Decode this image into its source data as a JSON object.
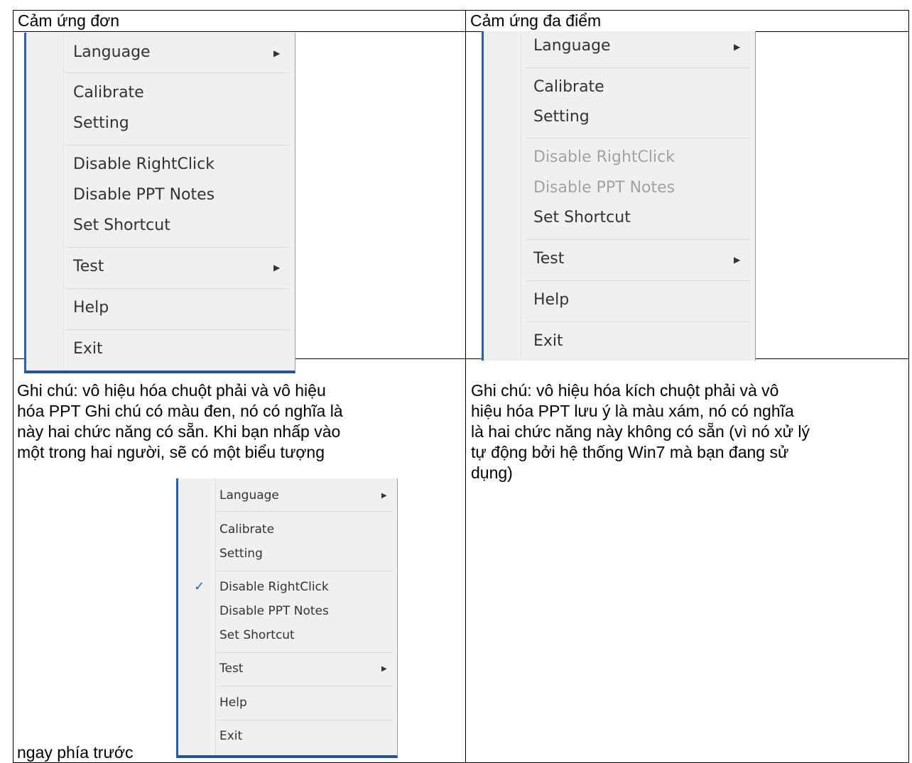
{
  "headers": {
    "left": "Cảm ứng đơn",
    "right": "Cảm ứng đa điểm"
  },
  "menu_single": {
    "items": [
      {
        "label": "Language",
        "submenu": true,
        "disabled": false
      },
      {
        "label": "Calibrate",
        "submenu": false,
        "disabled": false
      },
      {
        "label": "Setting",
        "submenu": false,
        "disabled": false
      },
      {
        "label": "Disable RightClick",
        "submenu": false,
        "disabled": false
      },
      {
        "label": "Disable PPT Notes",
        "submenu": false,
        "disabled": false
      },
      {
        "label": "Set Shortcut",
        "submenu": false,
        "disabled": false
      },
      {
        "label": "Test",
        "submenu": true,
        "disabled": false
      },
      {
        "label": "Help",
        "submenu": false,
        "disabled": false
      },
      {
        "label": "Exit",
        "submenu": false,
        "disabled": false
      }
    ]
  },
  "menu_multi": {
    "items": [
      {
        "label": "Language",
        "submenu": true,
        "disabled": false
      },
      {
        "label": "Calibrate",
        "submenu": false,
        "disabled": false
      },
      {
        "label": "Setting",
        "submenu": false,
        "disabled": false
      },
      {
        "label": "Disable RightClick",
        "submenu": false,
        "disabled": true
      },
      {
        "label": "Disable PPT Notes",
        "submenu": false,
        "disabled": true
      },
      {
        "label": "Set Shortcut",
        "submenu": false,
        "disabled": false
      },
      {
        "label": "Test",
        "submenu": true,
        "disabled": false
      },
      {
        "label": "Help",
        "submenu": false,
        "disabled": false
      },
      {
        "label": "Exit",
        "submenu": false,
        "disabled": false
      }
    ]
  },
  "menu_checked": {
    "checked_item": "Disable RightClick",
    "items": [
      {
        "label": "Language",
        "submenu": true,
        "disabled": false
      },
      {
        "label": "Calibrate",
        "submenu": false,
        "disabled": false
      },
      {
        "label": "Setting",
        "submenu": false,
        "disabled": false
      },
      {
        "label": "Disable RightClick",
        "submenu": false,
        "disabled": false,
        "checked": true
      },
      {
        "label": "Disable PPT Notes",
        "submenu": false,
        "disabled": false
      },
      {
        "label": "Set Shortcut",
        "submenu": false,
        "disabled": false
      },
      {
        "label": "Test",
        "submenu": true,
        "disabled": false
      },
      {
        "label": "Help",
        "submenu": false,
        "disabled": false
      },
      {
        "label": "Exit",
        "submenu": false,
        "disabled": false
      }
    ]
  },
  "notes": {
    "left_lines": [
      "Ghi chú: vô hiệu hóa chuột phải và vô hiệu",
      "hóa PPT Ghi chú có màu đen, nó có nghĩa là",
      "này hai chức năng có sẵn. Khi bạn nhấp vào",
      "một trong hai người, sẽ có một biểu tượng"
    ],
    "left_tail": "ngay phía trước",
    "right_lines": [
      "Ghi chú: vô hiệu hóa kích chuột phải và vô",
      "hiệu hóa PPT lưu ý là màu xám, nó có nghĩa",
      "là hai chức năng này không có sẵn (vì nó xử lý",
      "tự động bởi hệ thống Win7 mà bạn đang sử",
      "dụng)"
    ]
  }
}
